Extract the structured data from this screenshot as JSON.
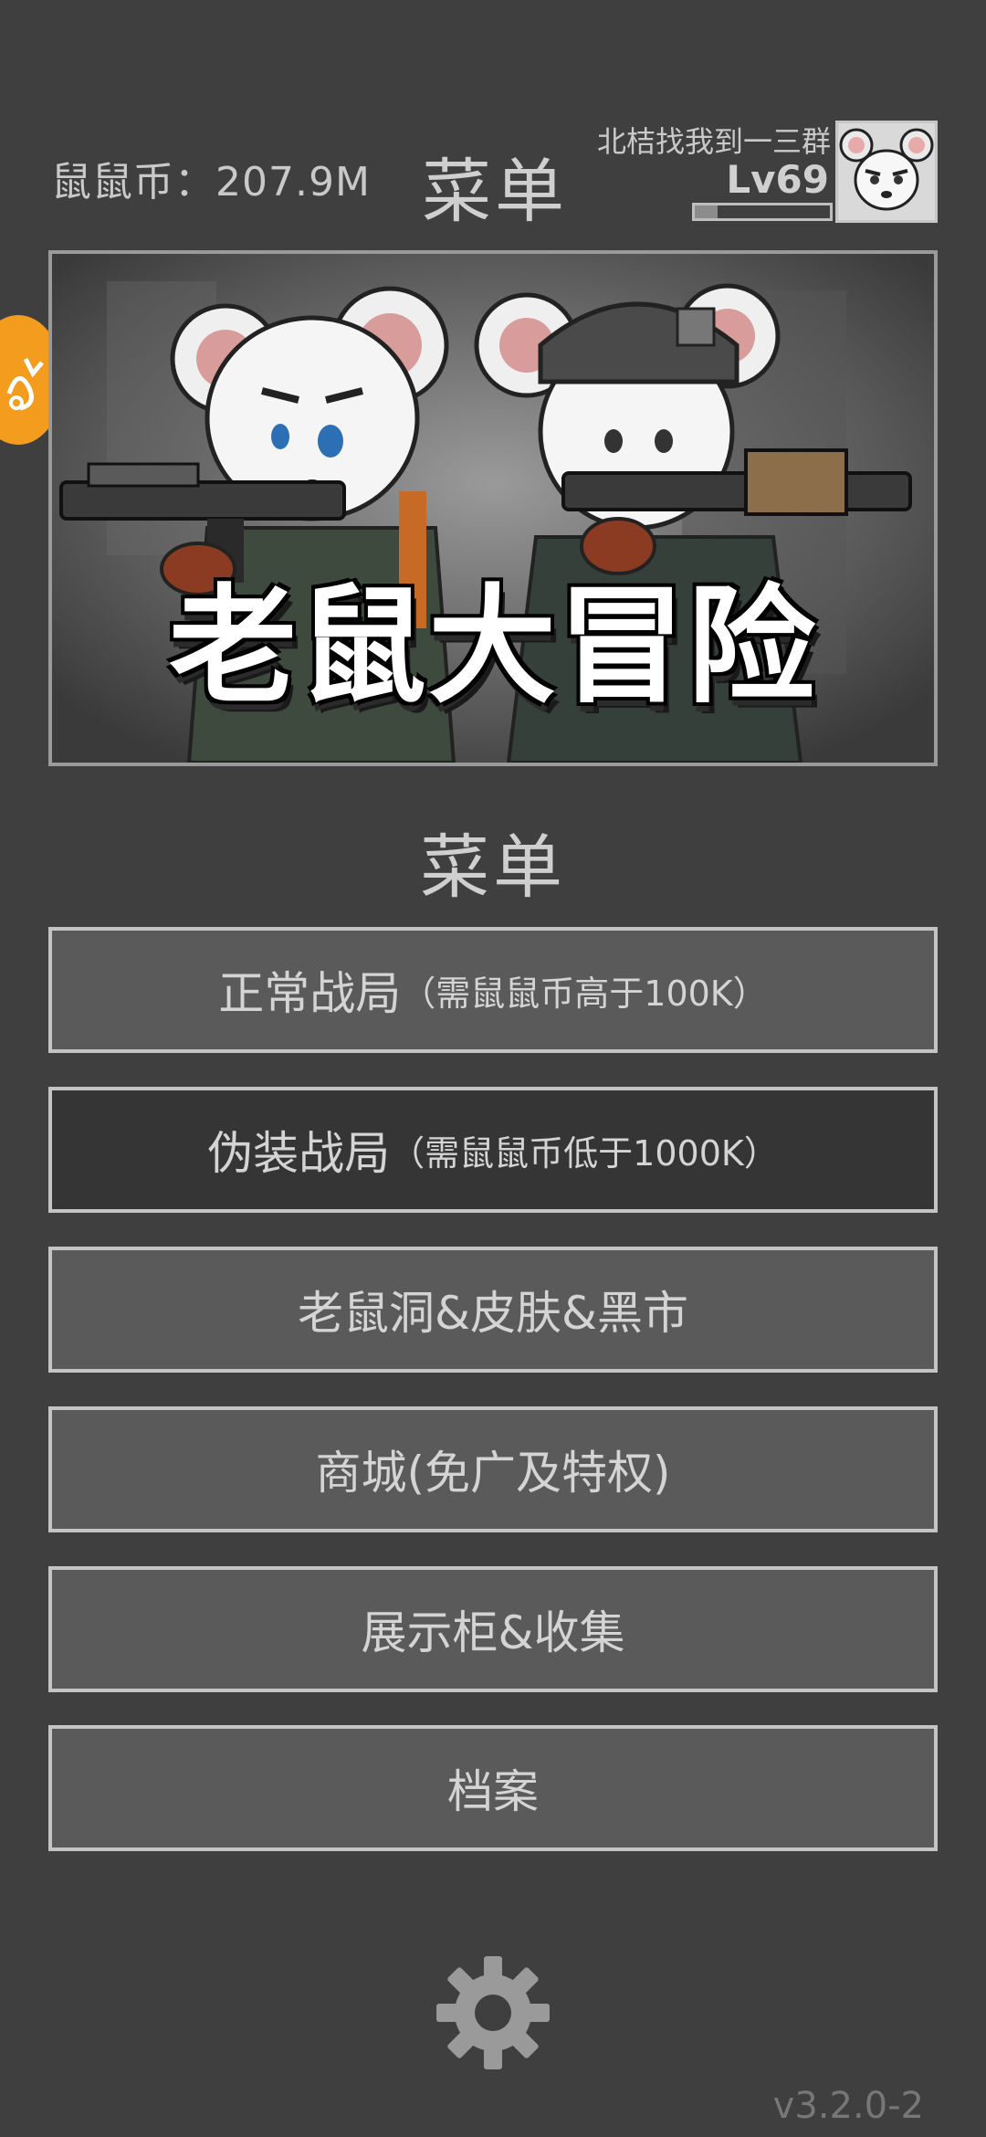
{
  "header": {
    "coins_text": "鼠鼠币：207.9M",
    "title": "菜单",
    "player_name": "北桔找我到一三群",
    "level": "Lv69",
    "xp_progress": 0.17
  },
  "banner": {
    "title": "老鼠大冒险"
  },
  "menu": {
    "heading": "菜单",
    "items": [
      {
        "label": "正常战局",
        "sub": "（需鼠鼠币高于100K）"
      },
      {
        "label": "伪装战局",
        "sub": "（需鼠鼠币低于1000K）"
      },
      {
        "label": "老鼠洞&皮肤&黑市",
        "sub": ""
      },
      {
        "label": "商城(免广及特权)",
        "sub": ""
      },
      {
        "label": "展示柜&收集",
        "sub": ""
      },
      {
        "label": "档案",
        "sub": ""
      }
    ]
  },
  "footer": {
    "version": "v3.2.0-2"
  },
  "colors": {
    "background": "#3f3f3f",
    "button": "#5a5a5a",
    "button_selected": "#353535",
    "border": "#c4c4c4",
    "badge": "#f39c1d"
  }
}
